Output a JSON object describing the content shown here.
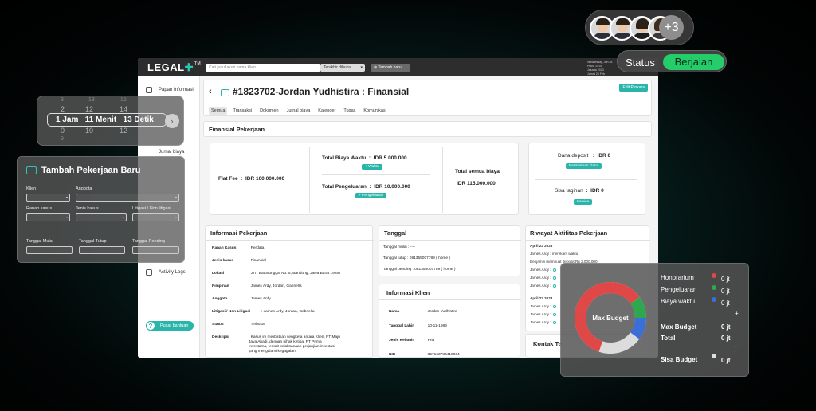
{
  "app": {
    "logo": "LEGAL",
    "logo_tm": "TM",
    "search_placeholder": "Cari judul akun nama klien",
    "filter_label": "Terakhir dibuka",
    "add_button": "Tambah baru",
    "user_info": [
      "Wednesday, Jun 28",
      "Pukul 10:00",
      "Jakarta 2023",
      "Jumat 28 Feb"
    ]
  },
  "sidebar": {
    "items": [
      {
        "label": "Papan Informasi",
        "icon": "home-icon"
      },
      {
        "label": "Jurnal biaya",
        "icon": "journal-icon"
      },
      {
        "label": "Activity Logs",
        "icon": "activity-icon"
      }
    ],
    "help": "Pusat bantuan"
  },
  "header": {
    "title": "#1823702-Jordan Yudhistira : Finansial",
    "edit_button": "Edit Perkara",
    "tabs": [
      "Semua",
      "Transaksi",
      "Dokumen",
      "Jurnal biaya",
      "Kalender",
      "Tugas",
      "Komunikasi"
    ]
  },
  "finance": {
    "section_title": "Finansial Pekerjaan",
    "flat_fee_label": "Flat Fee",
    "flat_fee": "IDR 100.000.000",
    "time_cost_label": "Total Biaya Waktu",
    "time_cost": "IDR 5.000.000",
    "time_button": "+ Waktu",
    "expense_label": "Total Pengeluaran",
    "expense": "IDR 10.000.000",
    "expense_button": "+ Pengeluaran",
    "total_label": "Total semua biaya",
    "total": "IDR 115.000.000",
    "deposit_label": "Dana deposit",
    "deposit": "IDR 0",
    "deposit_button": "Permintaan Dana",
    "remaining_label": "Sisa tagihan",
    "remaining": "IDR 0",
    "invoice_button": "Invoice"
  },
  "job_info": {
    "title": "Informasi Pekerjaan",
    "rows": [
      {
        "k": "Ranah Kasus",
        "v": "Perdata"
      },
      {
        "k": "Jenis kasus",
        "v": "Finansial"
      },
      {
        "k": "Lokasi",
        "v": "Jln . Batununggal No. 5, Bandung, Jawa Barat 19287"
      },
      {
        "k": "Pimpinan",
        "v": "James Ardy, Jordan, Gabriella"
      },
      {
        "k": "Anggota",
        "v": "James Ardy"
      },
      {
        "k": "Litigasi / Non Litigasi",
        "v": "James Ardy, Jordan, Gabriella"
      },
      {
        "k": "Status",
        "v": "Terbuka"
      },
      {
        "k": "Deskripsi",
        "v": "Kasus ini melibatkan sengketa antara Klien, PT Maju Jaya Abadi, dengan pihak ketiga, PT Prima Investama, terkait pelaksanaan perjanjian investasi yang mengalami kegagalan."
      }
    ]
  },
  "dates": {
    "title": "Tanggal",
    "rows": [
      "Tanggal mulai : ----",
      "Tanggal tutup : 081355007789 ( home )",
      "Tanggal pending : 081355007789 ( home )"
    ]
  },
  "client": {
    "title": "Informasi Klien",
    "rows": [
      {
        "k": "Nama",
        "v": ": Jordan Yudhistira"
      },
      {
        "k": "Tanggal Lahir",
        "v": ": 10-11-1989"
      },
      {
        "k": "Jenis Kelamin",
        "v": ": Pria"
      },
      {
        "k": "NIK",
        "v": ": 357163783410004"
      }
    ]
  },
  "history": {
    "title": "Riwayat Aktifitas Pekerjaan",
    "date1": "April 23 2023",
    "entries1": [
      "James Ardy : merekam waktu",
      "Benjamin membuat deposit Rp 2.000.000",
      "James Ardy :",
      "James Ardy :",
      "James Ardy :"
    ],
    "date2": "April 22 2023",
    "entries2": [
      "James Ardy :",
      "James Ardy :",
      "James Ardy :"
    ],
    "contact_title": "Kontak Te"
  },
  "timer": {
    "above": [
      "2",
      "12",
      "14"
    ],
    "value": [
      "1 Jam",
      "11 Menit",
      "13 Detik"
    ],
    "below": [
      "0",
      "10",
      "12"
    ],
    "top_faint": [
      "3",
      "13",
      "15"
    ],
    "bottom_faint": [
      "9"
    ]
  },
  "add_job": {
    "title": "Tambah Pekerjaan Baru",
    "fields": [
      "Klien",
      "Anggota",
      "Ranah kasus",
      "Jenis kasus",
      "Litigasi / Non litigasi",
      "Tanggal Mulai",
      "Tanggal Tutup",
      "Tanggal Pending"
    ]
  },
  "team": {
    "more": "+3"
  },
  "status": {
    "label": "Status",
    "value": "Berjalan"
  },
  "budget": {
    "center_label": "Max Budget",
    "items": [
      {
        "label": "Honorarium",
        "value": "0 jt",
        "color": "#e04848"
      },
      {
        "label": "Pengeluaran",
        "value": "0 jt",
        "color": "#2ea84e"
      },
      {
        "label": "Biaya waktu",
        "value": "0 jt",
        "color": "#3b6fd6"
      }
    ],
    "max_label": "Max Budget",
    "max_value": "0 jt",
    "total_label": "Total",
    "total_value": "0 jt",
    "remain_label": "Sisa Budget",
    "remain_value": "0 jt",
    "plus": "+",
    "minus": "-"
  },
  "colors": {
    "accent": "#2ab5aa",
    "status_green": "#25cc6a"
  }
}
